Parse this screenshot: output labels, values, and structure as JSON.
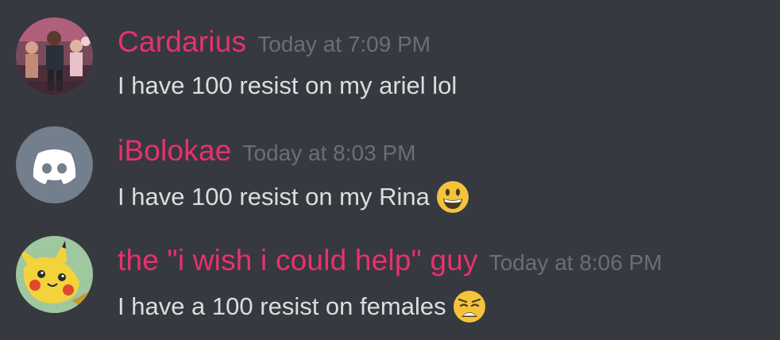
{
  "messages": [
    {
      "username": "Cardarius",
      "timestamp": "Today at 7:09 PM",
      "text": "I have 100 resist on my ariel lol",
      "avatar": "photo-avatar",
      "emoji": null
    },
    {
      "username": "iBolokae",
      "timestamp": "Today at 8:03 PM",
      "text": "I have 100 resist on my Rina",
      "avatar": "discord-default-avatar",
      "emoji": "grinning-face"
    },
    {
      "username": "the \"i wish i could help\" guy",
      "timestamp": "Today at 8:06 PM",
      "text": "I have a 100 resist on females",
      "avatar": "pikachu-avatar",
      "emoji": "weary-face"
    }
  ],
  "colors": {
    "background": "#36393f",
    "username": "#e9306f",
    "timestamp": "#6b6e74",
    "message_text": "#dcddde",
    "discord_avatar_bg": "#747f8d"
  }
}
